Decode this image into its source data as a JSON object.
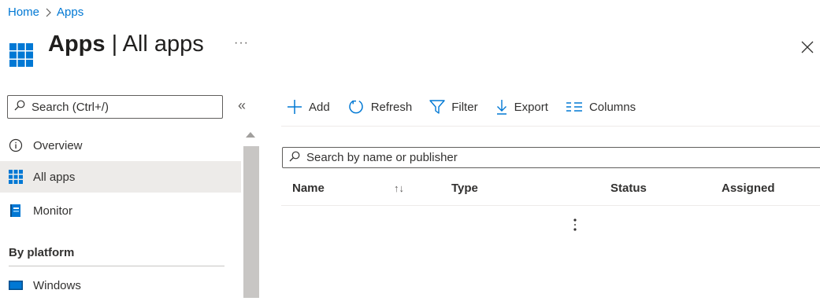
{
  "breadcrumb": {
    "home": "Home",
    "separator_icon": "chevron-right-icon",
    "current": "Apps"
  },
  "header": {
    "title": "Apps",
    "divider": "|",
    "subtitle": "All apps",
    "more_label": "···",
    "close_icon": "close-icon",
    "icon": "grid-apps-icon"
  },
  "sidebar": {
    "search_placeholder": "Search (Ctrl+/)",
    "collapse_label": "«",
    "items": [
      {
        "label": "Overview",
        "icon": "info-icon",
        "active": false
      },
      {
        "label": "All apps",
        "icon": "grid-apps-icon",
        "active": true
      },
      {
        "label": "Monitor",
        "icon": "monitor-book-icon",
        "active": false
      }
    ],
    "section_title": "By platform",
    "platform_items": [
      {
        "label": "Windows",
        "icon": "windows-screen-icon"
      }
    ]
  },
  "toolbar": {
    "add_label": "Add",
    "refresh_label": "Refresh",
    "filter_label": "Filter",
    "export_label": "Export",
    "columns_label": "Columns"
  },
  "main": {
    "search_placeholder": "Search by name or publisher",
    "columns": [
      "Name",
      "Type",
      "Status",
      "Assigned"
    ],
    "sort_indicator": "↑↓",
    "rows": []
  },
  "colors": {
    "accent": "#0078d4",
    "active_bg": "#edebe9",
    "scroll_thumb": "#c8c6c4",
    "text": "#323130"
  }
}
